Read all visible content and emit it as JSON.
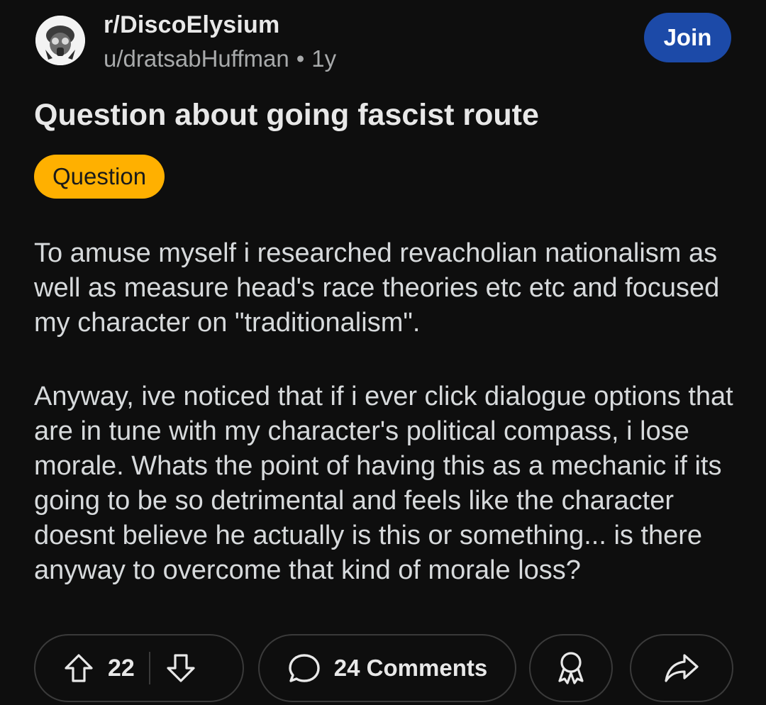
{
  "post": {
    "subreddit": "r/DiscoElysium",
    "author": "u/dratsabHuffman",
    "separator": "•",
    "age": "1y",
    "join_label": "Join",
    "title": "Question about going fascist route",
    "flair": "Question",
    "body_paragraphs": [
      "To amuse myself i researched revacholian nationalism as well as measure head's race theories etc etc and focused my character on \"traditionalism\".",
      "Anyway, ive noticed that if i ever click dialogue options that are in tune with my character's political compass, i lose morale. Whats the point of having this as a mechanic if its going to be so detrimental and feels like the character doesnt believe he actually is this or something... is there anyway to overcome that kind of morale loss?"
    ]
  },
  "actions": {
    "upvote_icon": "upvote-arrow-icon",
    "vote_count": "22",
    "downvote_icon": "downvote-arrow-icon",
    "comment_icon": "speech-bubble-icon",
    "comments_label": "24 Comments",
    "award_icon": "award-ribbon-icon",
    "share_icon": "share-arrow-icon"
  },
  "colors": {
    "background": "#0e0e0e",
    "join_button": "#1c4aa8",
    "flair": "#ffb000",
    "pill_border": "#3a3a3a"
  }
}
